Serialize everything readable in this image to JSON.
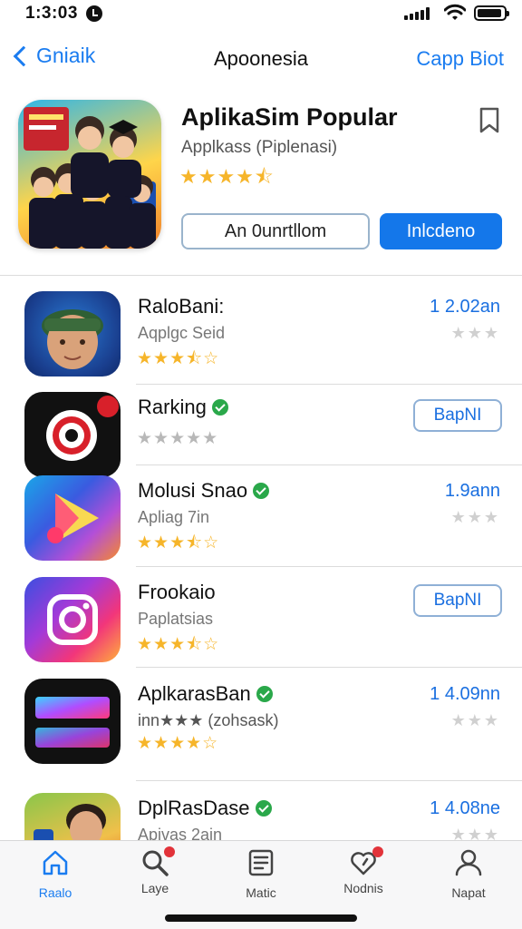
{
  "status_bar": {
    "time": "1:3:03"
  },
  "nav": {
    "back_label": "Gniaik",
    "title": "Apoonesia",
    "right_label": "Capp Biot"
  },
  "hero": {
    "title": "AplikaSim Popular",
    "subtitle": "Applkass (Piplenasi)",
    "stars": "★★★★⯪",
    "button_outline": "An 0unrtllom",
    "button_primary": "Inlcdeno"
  },
  "apps": [
    {
      "name": "RaloBani:",
      "subtitle": "Aqplgc Seid",
      "stars": "★★★⯪☆",
      "meta": "1  2.02an",
      "gray_stars": "★★★",
      "verified": false
    },
    {
      "name": "Rarking",
      "subtitle": "",
      "stars": "★★★★★",
      "button": "BapNI",
      "verified": true
    },
    {
      "name": "Molusi Snao",
      "subtitle": "Apliag 7in",
      "stars": "★★★⯪☆",
      "meta": "1.9ann",
      "gray_stars": "★★★",
      "verified": true
    },
    {
      "name": "Frookaio",
      "subtitle": "Paplatsias",
      "stars": "★★★⯪☆",
      "button": "BapNI",
      "verified": false
    },
    {
      "name": "AplkarasBan",
      "subtitle": "inn★★★ (zohsask)",
      "stars": "★★★★☆",
      "meta": "1  4.09nn",
      "gray_stars": "★★★",
      "verified": true
    },
    {
      "name": "DplRasDase",
      "subtitle": "Apivas 2ain",
      "stars": "",
      "meta": "1  4.08ne",
      "gray_stars": "★★★",
      "verified": true
    }
  ],
  "tabs": [
    {
      "label": "Raalo",
      "icon": "home-icon",
      "active": true
    },
    {
      "label": "Laye",
      "icon": "search-icon",
      "active": false
    },
    {
      "label": "Matic",
      "icon": "list-icon",
      "active": false
    },
    {
      "label": "Nodnis",
      "icon": "heart-gauge-icon",
      "active": false
    },
    {
      "label": "Napat",
      "icon": "person-icon",
      "active": false
    }
  ],
  "colors": {
    "accent": "#1a7cf0",
    "primary_button": "#1477ea",
    "star": "#f6b52a",
    "verified": "#2aa84a",
    "badge": "#e2333a"
  }
}
